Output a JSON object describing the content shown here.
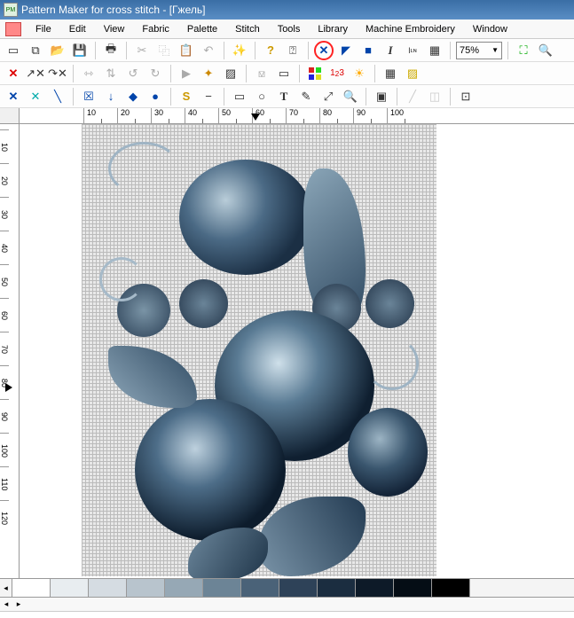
{
  "title": "Pattern Maker for cross stitch - [Гжель]",
  "menu": [
    "File",
    "Edit",
    "View",
    "Fabric",
    "Palette",
    "Stitch",
    "Tools",
    "Library",
    "Machine Embroidery",
    "Window"
  ],
  "zoom": "75%",
  "ruler_h": [
    "10",
    "20",
    "30",
    "40",
    "50",
    "60",
    "70",
    "80",
    "90",
    "100"
  ],
  "ruler_h_marker_at": 195,
  "ruler_v": [
    "10",
    "20",
    "30",
    "40",
    "50",
    "60",
    "70",
    "80",
    "90",
    "100",
    "110",
    "120"
  ],
  "ruler_v_marker_at": 288,
  "toolbar1": {
    "new": "new-icon",
    "clone": "copy-doc-icon",
    "open": "open-icon",
    "save": "save-icon",
    "print": "print-icon",
    "cut": "cut-icon",
    "copy": "copy-icon",
    "paste": "paste-icon",
    "undo": "undo-icon",
    "special": "magic-icon",
    "help": "help-icon",
    "whats": "whats-this-icon",
    "full_stitch_x": "full-stitch-icon",
    "half": "triangle-icon",
    "fill": "fill-icon",
    "italic": "I",
    "line": "Iʟɴ",
    "grid": "grid-icon",
    "fit": "fit-icon",
    "zoomtool": "zoom-tool-icon"
  },
  "toolbar2": {
    "delx": "delete-stitch-icon",
    "arrowx": "arrow-x-icon",
    "overx": "over-x-icon",
    "flip_h": "flip-h-icon",
    "flip_v": "flip-v-icon",
    "rot_l": "rotate-left-icon",
    "rot_r": "rotate-right-icon",
    "play": "play-icon",
    "sparkle": "sparkle-icon",
    "pattern": "pattern-icon",
    "crop": "crop-icon",
    "palette_sq": "palette-squares-icon",
    "num": "1²3",
    "sun": "sun-icon",
    "grid_toggle": "grid-toggle-icon",
    "hatch": "hatch-icon"
  },
  "toolbar3": {
    "x_blue": "x-stitch-icon",
    "x_teal": "x-stitch-alt-icon",
    "diag": "diagonal-icon",
    "box_diag": "box-diag-icon",
    "arrowdown": "arrow-down-icon",
    "diamond": "diamond-icon",
    "circle": "circle-icon",
    "s": "S",
    "dash": "−",
    "sel_rect": "select-rect-icon",
    "sel_circ": "select-circle-icon",
    "text": "T",
    "pencil": "pencil-icon",
    "eyedrop": "eyedropper-icon",
    "zoom": "magnifier-icon",
    "play2": "play-icon",
    "line2": "line-mode-icon",
    "panel": "panel-icon"
  },
  "palette": [
    "#ffffff",
    "#e8edf0",
    "#d5dce2",
    "#b8c4cd",
    "#96a8b5",
    "#6c8496",
    "#4a6278",
    "#2e4258",
    "#1b2d40",
    "#0d1a28",
    "#050d15",
    "#000000"
  ],
  "pattern_name": "Гжель"
}
